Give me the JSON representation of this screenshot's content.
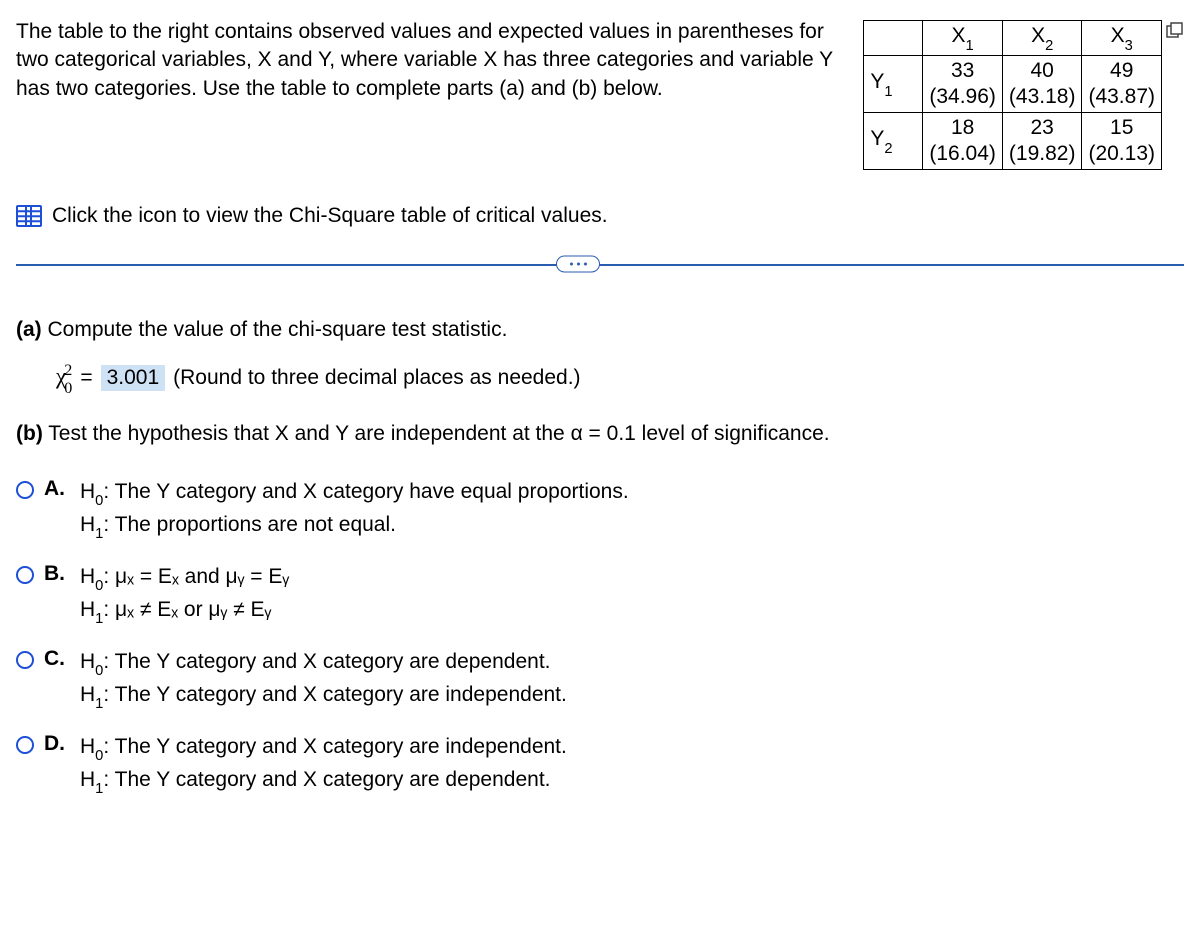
{
  "instructions": "The table to the right contains observed values and expected values in parentheses for two categorical variables, X and Y, where variable X has three categories and variable Y has two categories. Use the table to complete parts (a) and (b) below.",
  "table": {
    "col_headers": [
      "X",
      "X",
      "X"
    ],
    "col_subs": [
      "1",
      "2",
      "3"
    ],
    "row_headers": [
      "Y",
      "Y"
    ],
    "row_subs": [
      "1",
      "2"
    ],
    "cells": [
      [
        {
          "obs": "33",
          "exp": "(34.96)"
        },
        {
          "obs": "40",
          "exp": "(43.18)"
        },
        {
          "obs": "49",
          "exp": "(43.87)"
        }
      ],
      [
        {
          "obs": "18",
          "exp": "(16.04)"
        },
        {
          "obs": "23",
          "exp": "(19.82)"
        },
        {
          "obs": "15",
          "exp": "(20.13)"
        }
      ]
    ]
  },
  "chi_link": "Click the icon to view the Chi-Square table of critical values.",
  "part_a": {
    "label": "(a)",
    "text": "Compute the value of the chi-square test statistic.",
    "symbol_base": "χ",
    "symbol_sup": "2",
    "symbol_sub": "0",
    "equals": "=",
    "value": "3.001",
    "hint": "(Round to three decimal places as needed.)"
  },
  "part_b": {
    "label": "(b)",
    "text_before": "Test the hypothesis that X and Y are independent at the ",
    "alpha_sym": "α",
    "alpha_eq": " = 0.1 level of significance.",
    "options": [
      {
        "letter": "A.",
        "line1_pre": "H",
        "line1_sub": "0",
        "line1_post": ": The Y category and X category have equal proportions.",
        "line2_pre": "H",
        "line2_sub": "1",
        "line2_post": ": The proportions are not equal."
      },
      {
        "letter": "B.",
        "line1_pre": "H",
        "line1_sub": "0",
        "line1_post_math": ": μₓ = Eₓ and μᵧ = Eᵧ",
        "line2_pre": "H",
        "line2_sub": "1",
        "line2_post_math": ": μₓ ≠ Eₓ or μᵧ ≠ Eᵧ"
      },
      {
        "letter": "C.",
        "line1_pre": "H",
        "line1_sub": "0",
        "line1_post": ": The Y category and X category are dependent.",
        "line2_pre": "H",
        "line2_sub": "1",
        "line2_post": ": The Y category and X category are independent."
      },
      {
        "letter": "D.",
        "line1_pre": "H",
        "line1_sub": "0",
        "line1_post": ": The Y category and X category are independent.",
        "line2_pre": "H",
        "line2_sub": "1",
        "line2_post": ": The Y category and X category are dependent."
      }
    ]
  }
}
